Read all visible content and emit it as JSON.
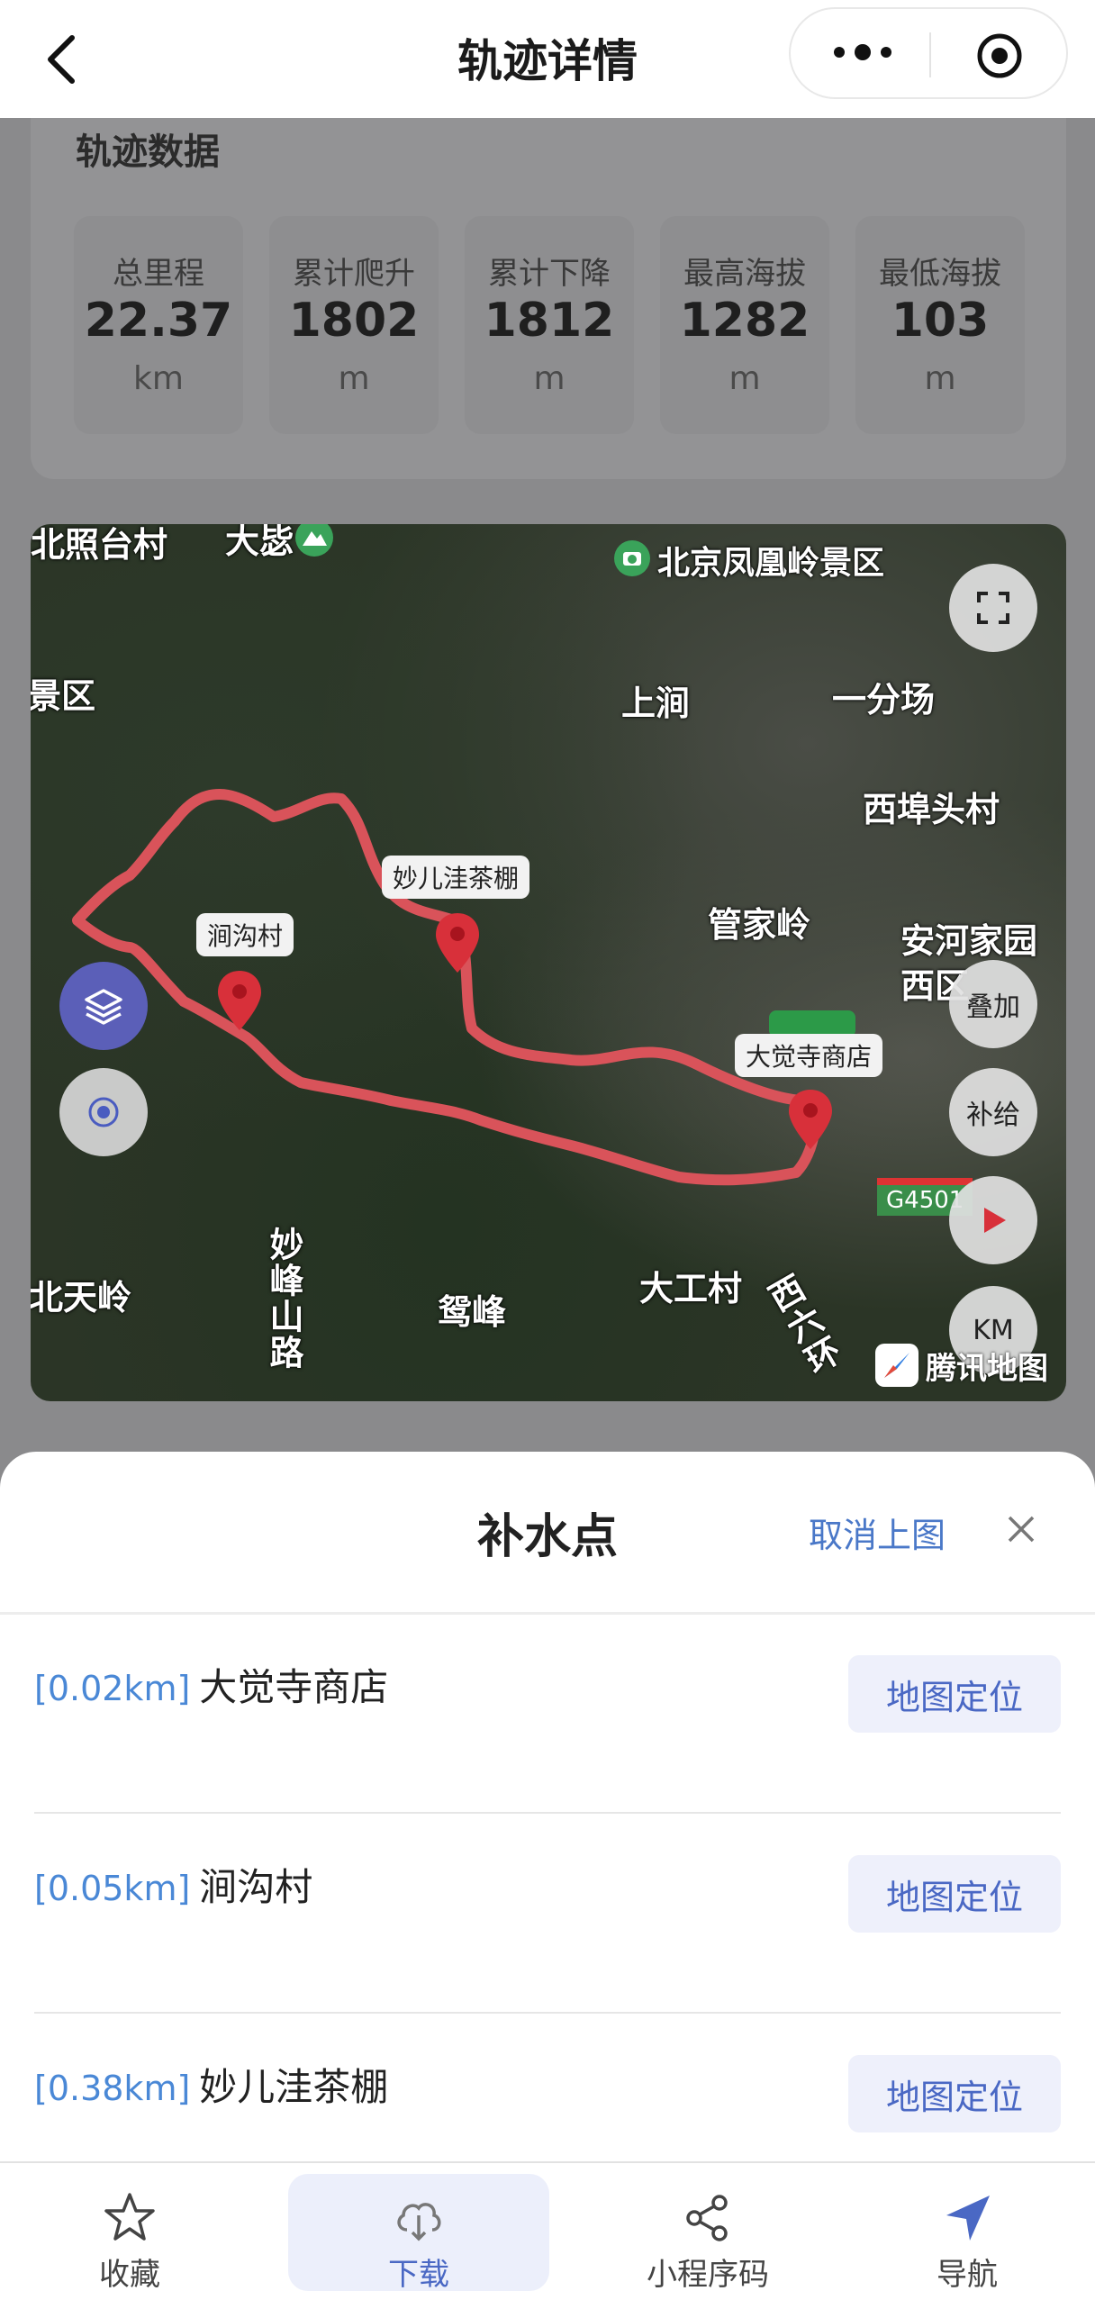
{
  "header": {
    "title": "轨迹详情"
  },
  "stats": {
    "title": "轨迹数据",
    "items": [
      {
        "label": "总里程",
        "value": "22.37",
        "unit": "km"
      },
      {
        "label": "累计爬升",
        "value": "1802",
        "unit": "m"
      },
      {
        "label": "累计下降",
        "value": "1812",
        "unit": "m"
      },
      {
        "label": "最高海拔",
        "value": "1282",
        "unit": "m"
      },
      {
        "label": "最低海拔",
        "value": "103",
        "unit": "m"
      }
    ]
  },
  "map": {
    "labels": {
      "beizhaotai": "北照台村",
      "dabi": "大毖",
      "fenghuangling": "北京凤凰岭景区",
      "jingqu": "景区",
      "shangjian": "上涧",
      "yifenchang": "一分场",
      "xibutoucun": "西埠头村",
      "guanjialing": "管家岭",
      "anhejiayuan": "安河家园",
      "xiqu": "西区",
      "beitianling": "北天岭",
      "miaofengshanlu": "妙峰山路",
      "yuanfeng": "鸳峰",
      "dagongcun": "大工村",
      "xiliuhuan": "西六环",
      "g4501": "G4501",
      "attribution": "腾讯地图"
    },
    "pois": {
      "jiangoucun": "涧沟村",
      "miaoerwa": "妙儿洼茶棚",
      "dajuesi": "大觉寺商店"
    },
    "controls": {
      "overlay": "叠加",
      "supply": "补给",
      "km": "KM"
    },
    "route_color": "#d9535a"
  },
  "sheet": {
    "title": "补水点",
    "cancel": "取消上图",
    "items": [
      {
        "distance": "[0.02km]",
        "name": "大觉寺商店",
        "action": "地图定位"
      },
      {
        "distance": "[0.05km]",
        "name": "涧沟村",
        "action": "地图定位"
      },
      {
        "distance": "[0.38km]",
        "name": "妙儿洼茶棚",
        "action": "地图定位"
      }
    ]
  },
  "tabbar": {
    "items": [
      {
        "label": "收藏",
        "icon": "star-icon"
      },
      {
        "label": "下载",
        "icon": "cloud-download-icon"
      },
      {
        "label": "小程序码",
        "icon": "share-icon"
      },
      {
        "label": "导航",
        "icon": "navigation-arrow-icon"
      }
    ]
  }
}
